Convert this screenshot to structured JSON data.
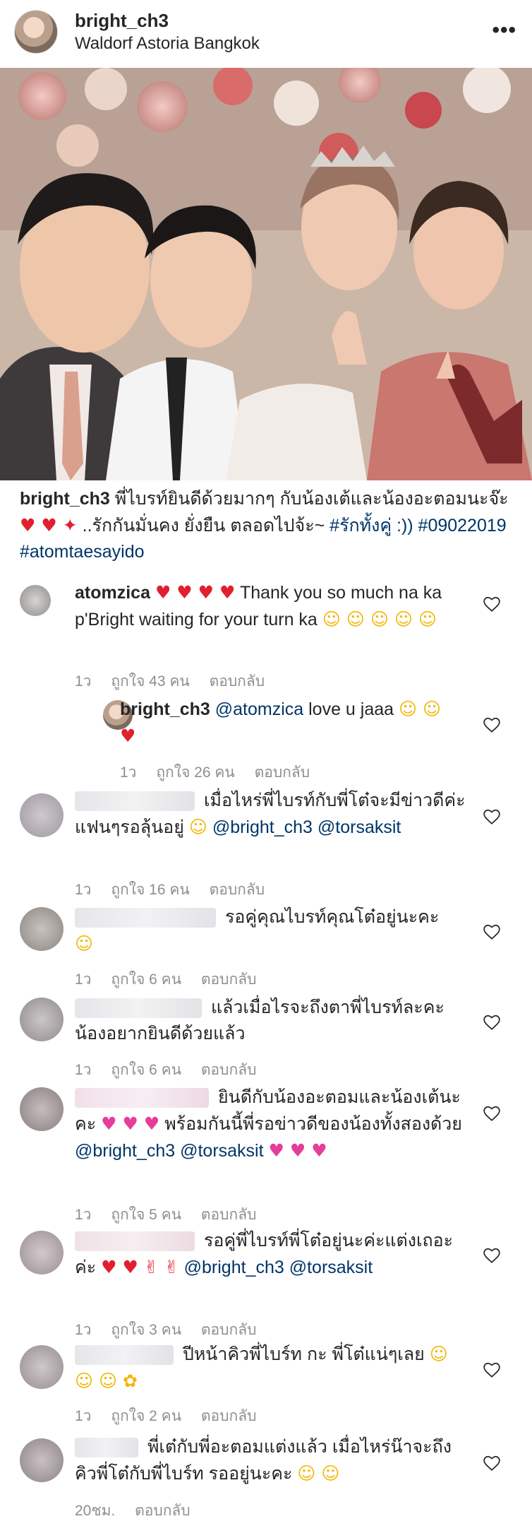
{
  "header": {
    "username": "bright_ch3",
    "location": "Waldorf Astoria Bangkok",
    "more_label": "•••"
  },
  "caption": {
    "username": "bright_ch3",
    "text_1": "พี่ไบรท์ยินดีด้วยมากๆ กับน้องเต้และน้องอะตอมนะจ๊ะ",
    "emojis_1": "♥ ♥ ✦",
    "text_2": "..รักกันมั่นคง ยั่งยืน ตลอดไปจ้ะ~",
    "tags": "#รักทั้งคู่ :)) #09022019 #atomtaesayido"
  },
  "comments": [
    {
      "username": "atomzica",
      "hearts": "♥ ♥ ♥ ♥",
      "text": "Thank you so much na ka p'Bright",
      "text_2": "waiting for your turn ka",
      "emojis": "☺ ☺ ☺ ☺ ☺",
      "time": "1ว",
      "likes": "ถูกใจ 43 คน",
      "reply": "ตอบกลับ"
    },
    {
      "username": "bright_ch3",
      "mention": "@atomzica",
      "text": "love u jaaa",
      "emojis": "☺ ☺",
      "hearts": "♥",
      "time": "1ว",
      "likes": "ถูกใจ 26 คน",
      "reply": "ตอบกลับ"
    },
    {
      "text": "เมื่อไหร่พี่ไบรท์กับพี่โต๋จะมีข่าวดีค่ะแฟนๆรอลุ้นอยู่",
      "emojis": "☺",
      "mention_1": "@bright_ch3",
      "mention_2": "@torsaksit",
      "time": "1ว",
      "likes": "ถูกใจ 16 คน",
      "reply": "ตอบกลับ"
    },
    {
      "text": "รอคู่คุณไบรท์คุณโต๋อยู่นะคะ",
      "emojis": "☺",
      "time": "1ว",
      "likes": "ถูกใจ 6 คน",
      "reply": "ตอบกลับ"
    },
    {
      "text": "แล้วเมื่อไรจะถึงตาพี่ไบรท์ละคะ น้องอยากยินดีด้วยแล้ว",
      "time": "1ว",
      "likes": "ถูกใจ 6 คน",
      "reply": "ตอบกลับ"
    },
    {
      "text": "ยินดีกับน้องอะตอมและน้องเต้นะคะ",
      "emojis": "♥ ♥ ♥",
      "text_2": "พร้อมกันนี้พี่รอข่าวดีของน้องทั้งสองด้วย",
      "mention_1": "@bright_ch3",
      "mention_2": "@torsaksit",
      "emojis_2": "♥ ♥ ♥",
      "time": "1ว",
      "likes": "ถูกใจ 5 คน",
      "reply": "ตอบกลับ"
    },
    {
      "text": "รอคู่พี่ไบรท์พี่โต๋อยู่นะค่ะแต่งเถอะค่ะ",
      "emojis": "♥ ♥ ✌ ✌",
      "mention_1": "@bright_ch3",
      "mention_2": "@torsaksit",
      "time": "1ว",
      "likes": "ถูกใจ 3 คน",
      "reply": "ตอบกลับ"
    },
    {
      "text": "ปีหน้าคิวพี่ไบร์ท กะ พี่โต๋แน่ๆเลย",
      "emojis": "☺ ☺ ☺ ✿",
      "time": "1ว",
      "likes": "ถูกใจ 2 คน",
      "reply": "ตอบกลับ"
    },
    {
      "text": "พี่เต๋กับพี่อะตอมแต่งแล้ว เมื่อไหร่น๊าจะถึงคิวพี่โต๋กับพี่ไบร์ท รออยู่นะคะ",
      "emojis": "☺ ☺",
      "time": "20ชม.",
      "reply": "ตอบกลับ"
    }
  ],
  "colors": {
    "text": "#262626",
    "meta": "#8e8e8e",
    "link": "#003569"
  }
}
